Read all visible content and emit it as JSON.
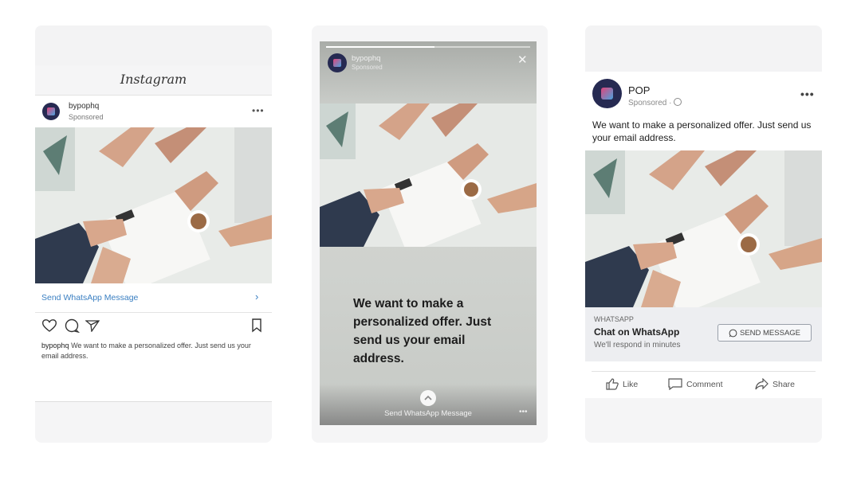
{
  "instagram": {
    "brand": "Instagram",
    "account_name": "bypophq",
    "sponsored": "Sponsored",
    "more": "•••",
    "cta_label": "Send WhatsApp Message",
    "cta_arrow": "›",
    "caption_user": "bypophq",
    "caption_text": "We want to make a personalized offer. Just send us your email address.",
    "icons": [
      "heart-icon",
      "comment-icon",
      "send-icon",
      "bookmark-icon"
    ],
    "link_color": "#3a7fc2"
  },
  "story": {
    "account_name": "bypophq",
    "sponsored": "Sponsored",
    "close": "✕",
    "progress": 0.53,
    "headline": "We want to make a personalized offer. Just send us your email address.",
    "cta_label": "Send WhatsApp Message",
    "dots": "•••"
  },
  "facebook": {
    "page_name": "POP",
    "sponsored": "Sponsored · ",
    "more": "•••",
    "post_text": "We want to make a personalized offer. Just send us your email address.",
    "ad_label": "WHATSAPP",
    "ad_title": "Chat on WhatsApp",
    "ad_subtitle": "We'll respond in minutes",
    "send_button": "SEND MESSAGE",
    "actions": {
      "like": "Like",
      "comment": "Comment",
      "share": "Share"
    },
    "avatar_color": "#262a52"
  }
}
